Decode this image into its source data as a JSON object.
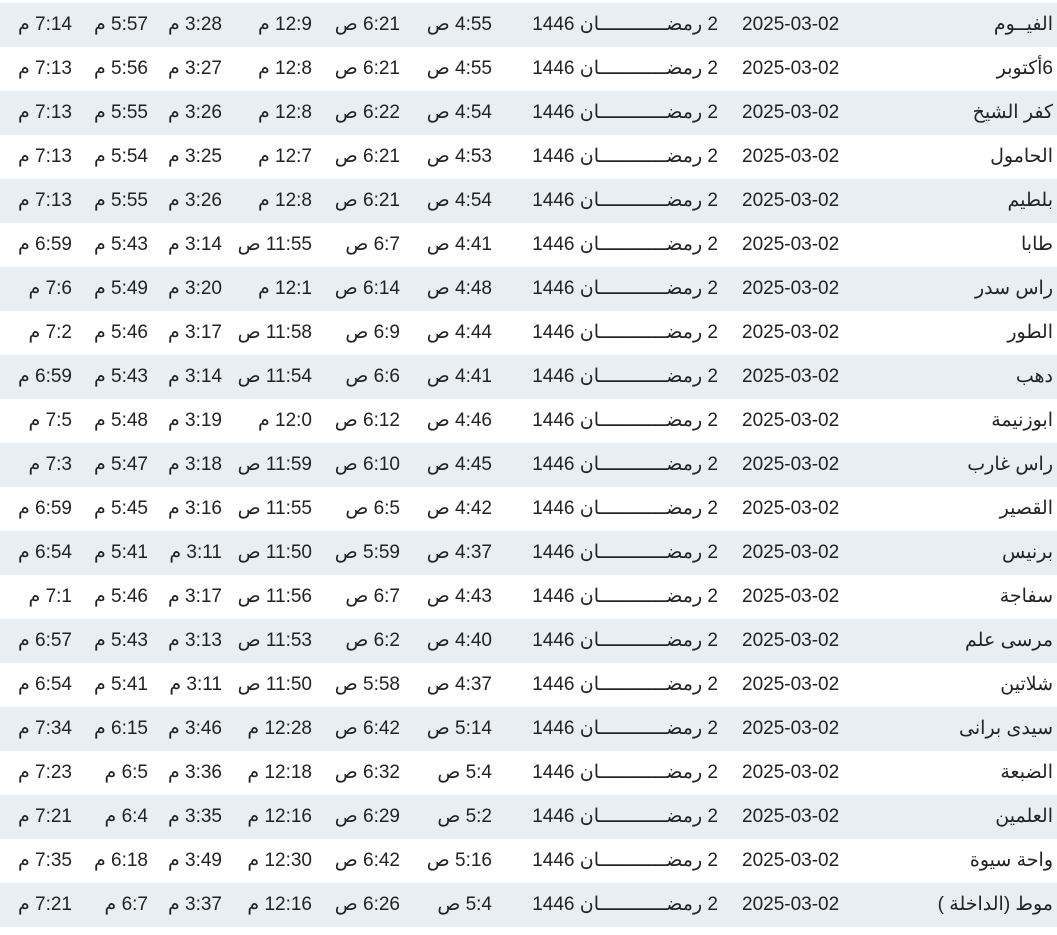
{
  "rows": [
    {
      "city": "الفيــوم",
      "date": "2025-03-02",
      "hijri": "2 رمضــــــــــــان 1446",
      "fajr": "4:55 ص",
      "sunrise": "6:21 ص",
      "dhuhr": "12:9 م",
      "asr": "3:28 م",
      "maghrib": "5:57 م",
      "isha": "7:14 م"
    },
    {
      "city": "6أكتوبر",
      "date": "2025-03-02",
      "hijri": "2 رمضــــــــــــان 1446",
      "fajr": "4:55 ص",
      "sunrise": "6:21 ص",
      "dhuhr": "12:8 م",
      "asr": "3:27 م",
      "maghrib": "5:56 م",
      "isha": "7:13 م"
    },
    {
      "city": "كفر الشيخ",
      "date": "2025-03-02",
      "hijri": "2 رمضــــــــــــان 1446",
      "fajr": "4:54 ص",
      "sunrise": "6:22 ص",
      "dhuhr": "12:8 م",
      "asr": "3:26 م",
      "maghrib": "5:55 م",
      "isha": "7:13 م"
    },
    {
      "city": "الحامول",
      "date": "2025-03-02",
      "hijri": "2 رمضــــــــــــان 1446",
      "fajr": "4:53 ص",
      "sunrise": "6:21 ص",
      "dhuhr": "12:7 م",
      "asr": "3:25 م",
      "maghrib": "5:54 م",
      "isha": "7:13 م"
    },
    {
      "city": "بلطيم",
      "date": "2025-03-02",
      "hijri": "2 رمضــــــــــــان 1446",
      "fajr": "4:54 ص",
      "sunrise": "6:21 ص",
      "dhuhr": "12:8 م",
      "asr": "3:26 م",
      "maghrib": "5:55 م",
      "isha": "7:13 م"
    },
    {
      "city": "طابا",
      "date": "2025-03-02",
      "hijri": "2 رمضــــــــــــان 1446",
      "fajr": "4:41 ص",
      "sunrise": "6:7 ص",
      "dhuhr": "11:55 ص",
      "asr": "3:14 م",
      "maghrib": "5:43 م",
      "isha": "6:59 م"
    },
    {
      "city": "راس سدر",
      "date": "2025-03-02",
      "hijri": "2 رمضــــــــــــان 1446",
      "fajr": "4:48 ص",
      "sunrise": "6:14 ص",
      "dhuhr": "12:1 م",
      "asr": "3:20 م",
      "maghrib": "5:49 م",
      "isha": "7:6 م"
    },
    {
      "city": "الطور",
      "date": "2025-03-02",
      "hijri": "2 رمضــــــــــــان 1446",
      "fajr": "4:44 ص",
      "sunrise": "6:9 ص",
      "dhuhr": "11:58 ص",
      "asr": "3:17 م",
      "maghrib": "5:46 م",
      "isha": "7:2 م"
    },
    {
      "city": "دهب",
      "date": "2025-03-02",
      "hijri": "2 رمضــــــــــــان 1446",
      "fajr": "4:41 ص",
      "sunrise": "6:6 ص",
      "dhuhr": "11:54 ص",
      "asr": "3:14 م",
      "maghrib": "5:43 م",
      "isha": "6:59 م"
    },
    {
      "city": "ابوزنيمة",
      "date": "2025-03-02",
      "hijri": "2 رمضــــــــــــان 1446",
      "fajr": "4:46 ص",
      "sunrise": "6:12 ص",
      "dhuhr": "12:0 م",
      "asr": "3:19 م",
      "maghrib": "5:48 م",
      "isha": "7:5 م"
    },
    {
      "city": "راس غارب",
      "date": "2025-03-02",
      "hijri": "2 رمضــــــــــــان 1446",
      "fajr": "4:45 ص",
      "sunrise": "6:10 ص",
      "dhuhr": "11:59 ص",
      "asr": "3:18 م",
      "maghrib": "5:47 م",
      "isha": "7:3 م"
    },
    {
      "city": "القصير",
      "date": "2025-03-02",
      "hijri": "2 رمضــــــــــــان 1446",
      "fajr": "4:42 ص",
      "sunrise": "6:5 ص",
      "dhuhr": "11:55 ص",
      "asr": "3:16 م",
      "maghrib": "5:45 م",
      "isha": "6:59 م"
    },
    {
      "city": "برنيس",
      "date": "2025-03-02",
      "hijri": "2 رمضــــــــــــان 1446",
      "fajr": "4:37 ص",
      "sunrise": "5:59 ص",
      "dhuhr": "11:50 ص",
      "asr": "3:11 م",
      "maghrib": "5:41 م",
      "isha": "6:54 م"
    },
    {
      "city": "سفاجة",
      "date": "2025-03-02",
      "hijri": "2 رمضــــــــــــان 1446",
      "fajr": "4:43 ص",
      "sunrise": "6:7 ص",
      "dhuhr": "11:56 ص",
      "asr": "3:17 م",
      "maghrib": "5:46 م",
      "isha": "7:1 م"
    },
    {
      "city": "مرسى علم",
      "date": "2025-03-02",
      "hijri": "2 رمضــــــــــــان 1446",
      "fajr": "4:40 ص",
      "sunrise": "6:2 ص",
      "dhuhr": "11:53 ص",
      "asr": "3:13 م",
      "maghrib": "5:43 م",
      "isha": "6:57 م"
    },
    {
      "city": "شلاتين",
      "date": "2025-03-02",
      "hijri": "2 رمضــــــــــــان 1446",
      "fajr": "4:37 ص",
      "sunrise": "5:58 ص",
      "dhuhr": "11:50 ص",
      "asr": "3:11 م",
      "maghrib": "5:41 م",
      "isha": "6:54 م"
    },
    {
      "city": "سيدى برانى",
      "date": "2025-03-02",
      "hijri": "2 رمضــــــــــــان 1446",
      "fajr": "5:14 ص",
      "sunrise": "6:42 ص",
      "dhuhr": "12:28 م",
      "asr": "3:46 م",
      "maghrib": "6:15 م",
      "isha": "7:34 م"
    },
    {
      "city": "الضبعة",
      "date": "2025-03-02",
      "hijri": "2 رمضــــــــــــان 1446",
      "fajr": "5:4 ص",
      "sunrise": "6:32 ص",
      "dhuhr": "12:18 م",
      "asr": "3:36 م",
      "maghrib": "6:5 م",
      "isha": "7:23 م"
    },
    {
      "city": "العلمين",
      "date": "2025-03-02",
      "hijri": "2 رمضــــــــــــان 1446",
      "fajr": "5:2 ص",
      "sunrise": "6:29 ص",
      "dhuhr": "12:16 م",
      "asr": "3:35 م",
      "maghrib": "6:4 م",
      "isha": "7:21 م"
    },
    {
      "city": "واحة سيوة",
      "date": "2025-03-02",
      "hijri": "2 رمضــــــــــــان 1446",
      "fajr": "5:16 ص",
      "sunrise": "6:42 ص",
      "dhuhr": "12:30 م",
      "asr": "3:49 م",
      "maghrib": "6:18 م",
      "isha": "7:35 م"
    },
    {
      "city": "موط (الداخلة )",
      "date": "2025-03-02",
      "hijri": "2 رمضــــــــــــان 1446",
      "fajr": "5:4 ص",
      "sunrise": "6:26 ص",
      "dhuhr": "12:16 م",
      "asr": "3:37 م",
      "maghrib": "6:7 م",
      "isha": "7:21 م"
    }
  ],
  "colors": {
    "row_shade": "#e8eef2",
    "row_plain": "#ffffff",
    "text": "#222222"
  }
}
